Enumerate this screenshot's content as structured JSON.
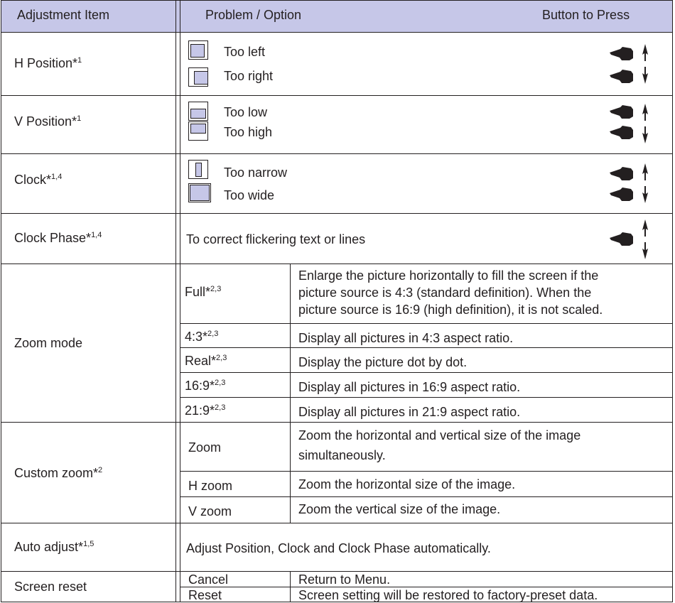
{
  "header": {
    "col1": "Adjustment Item",
    "col2": "Problem / Option",
    "col3": "Button to Press"
  },
  "rows": {
    "h_position": {
      "label": "H Position*",
      "sup": "1",
      "options": [
        "Too left",
        "Too right"
      ]
    },
    "v_position": {
      "label": "V Position*",
      "sup": "1",
      "options": [
        "Too low",
        "Too high"
      ]
    },
    "clock": {
      "label": "Clock*",
      "sup": "1,4",
      "options": [
        "Too narrow",
        "Too wide"
      ]
    },
    "clock_phase": {
      "label": "Clock Phase*",
      "sup": "1,4",
      "description": "To correct flickering text or lines"
    },
    "zoom_mode": {
      "label": "Zoom mode",
      "options": [
        {
          "name": "Full*",
          "sup": "2,3",
          "desc_lines": [
            "Enlarge the picture horizontally to fill the screen if the",
            "picture source is 4:3 (standard definition). When the",
            "picture source is 16:9 (high definition), it is not scaled."
          ]
        },
        {
          "name": "4:3*",
          "sup": "2,3",
          "desc": "Display all pictures in 4:3 aspect ratio."
        },
        {
          "name": "Real*",
          "sup": "2,3",
          "desc": "Display the picture dot by dot."
        },
        {
          "name": "16:9*",
          "sup": "2,3",
          "desc": "Display all pictures in 16:9 aspect ratio."
        },
        {
          "name": "21:9*",
          "sup": "2,3",
          "desc": "Display all pictures in 21:9 aspect ratio."
        }
      ]
    },
    "custom_zoom": {
      "label": "Custom zoom*",
      "sup": "2",
      "options": [
        {
          "name": "Zoom",
          "desc_lines": [
            "Zoom the horizontal and vertical size of the image",
            "simultaneously."
          ]
        },
        {
          "name": "H zoom",
          "desc": "Zoom the horizontal size of the image."
        },
        {
          "name": "V zoom",
          "desc": "Zoom the vertical size of the image."
        }
      ]
    },
    "auto_adjust": {
      "label": "Auto adjust*",
      "sup": "1,5",
      "description": "Adjust Position, Clock and Clock Phase automatically."
    },
    "screen_reset": {
      "label": "Screen reset",
      "options": [
        {
          "name": "Cancel",
          "desc": "Return to Menu."
        },
        {
          "name": "Reset",
          "desc": "Screen setting will be restored to factory-preset data."
        }
      ]
    }
  },
  "colors": {
    "header_bg": "#c6c7e8",
    "text": "#231f20",
    "icon_fill": "#c6c7e8"
  },
  "icons": {
    "pointer": "hand-pointer-left-icon",
    "arrows": "up-down-arrow-icon"
  }
}
